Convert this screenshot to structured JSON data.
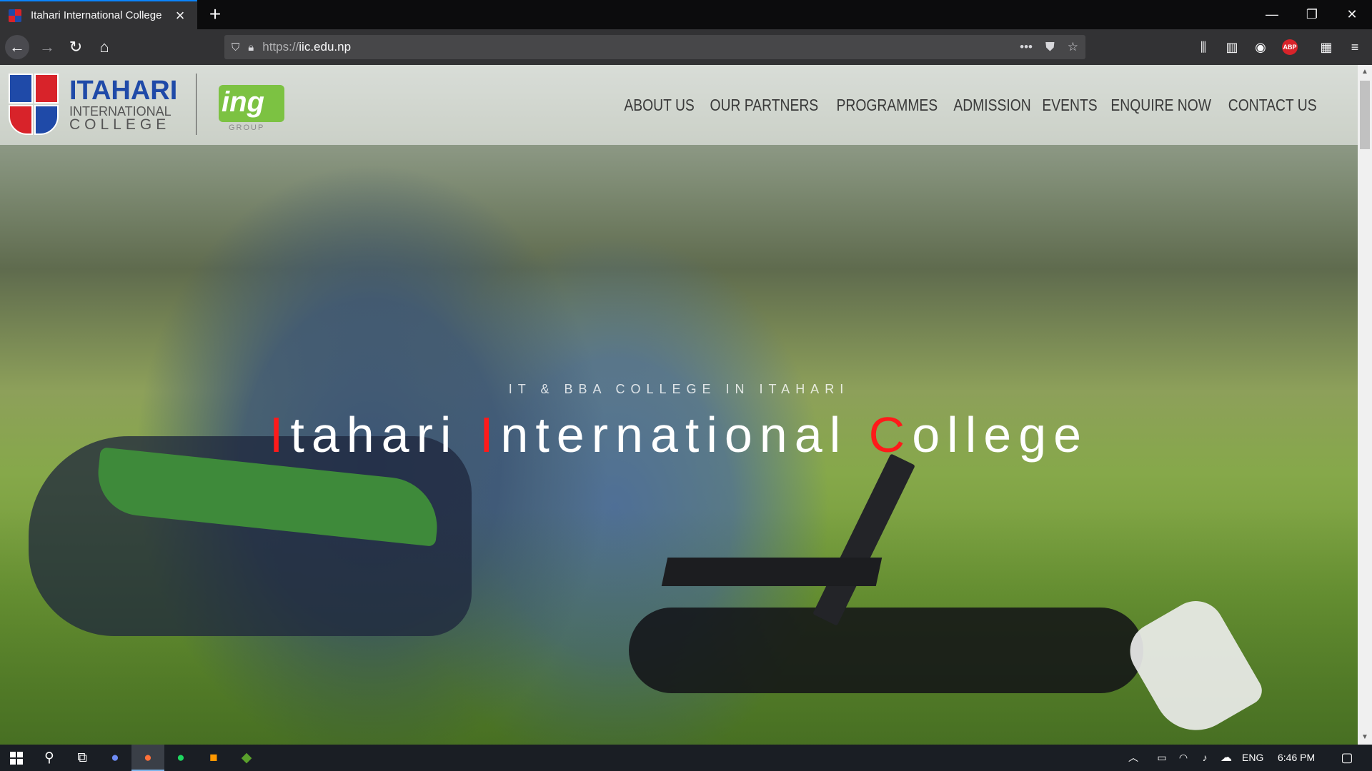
{
  "browser": {
    "tab_title": "Itahari International College",
    "url_protocol": "https://",
    "url_host": "iic.edu.np",
    "abp_label": "ABP"
  },
  "site": {
    "logo": {
      "line1": "ITAHARI",
      "line2": "INTERNATIONAL",
      "line3": "COLLEGE",
      "partner_mark": "ing",
      "partner_sub": "GROUP"
    },
    "nav": [
      {
        "label": "ABOUT US"
      },
      {
        "label": "OUR PARTNERS"
      },
      {
        "label": "PROGRAMMES"
      },
      {
        "label": "ADMISSION"
      },
      {
        "label": "EVENTS"
      },
      {
        "label": "ENQUIRE NOW"
      },
      {
        "label": "CONTACT US"
      }
    ],
    "hero": {
      "tagline": "IT & BBA COLLEGE IN ITAHARI",
      "title_parts": [
        "I",
        "tahari ",
        "I",
        "nternational ",
        "C",
        "ollege"
      ]
    }
  },
  "taskbar": {
    "language": "ENG",
    "time": "6:46 PM"
  },
  "colors": {
    "brand_blue": "#1f4aa8",
    "brand_red": "#d8232a",
    "partner_green": "#7cc242",
    "title_accent": "#ff1a1a"
  }
}
